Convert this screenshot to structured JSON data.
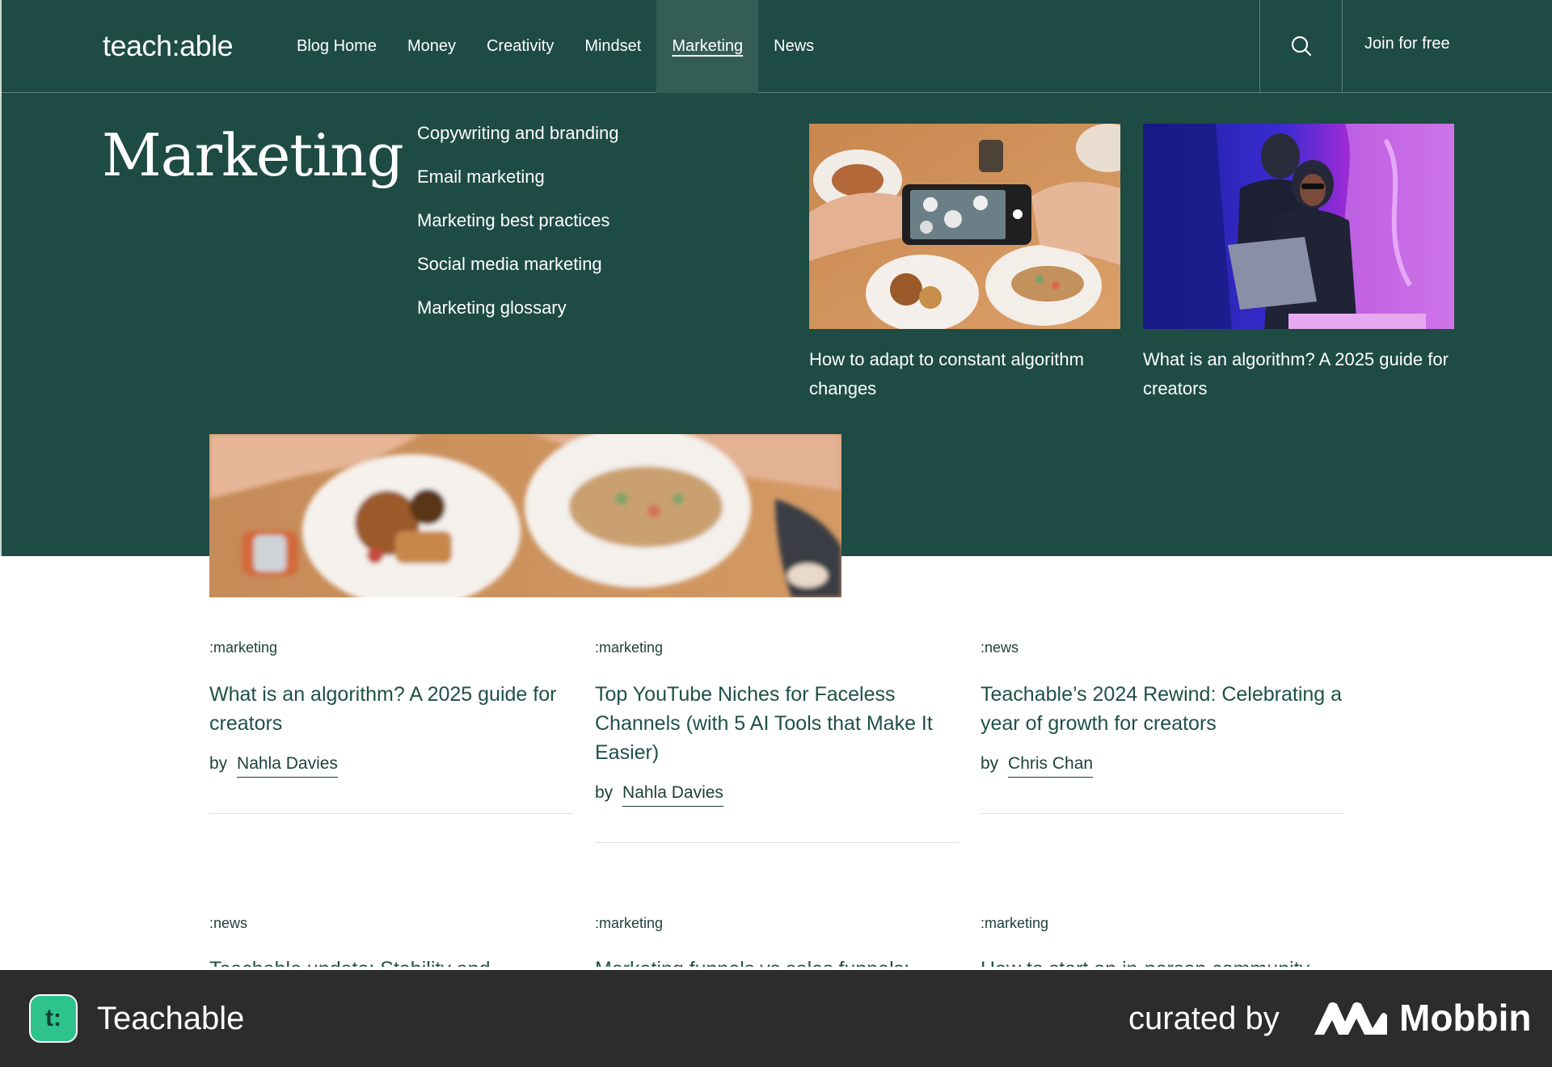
{
  "brand": {
    "logo": "teach:able"
  },
  "nav": {
    "items": [
      {
        "label": "Blog Home",
        "active": false
      },
      {
        "label": "Money",
        "active": false
      },
      {
        "label": "Creativity",
        "active": false
      },
      {
        "label": "Mindset",
        "active": false
      },
      {
        "label": "Marketing",
        "active": true
      },
      {
        "label": "News",
        "active": false
      }
    ],
    "search_icon": "search-icon",
    "join_label": "Join for free"
  },
  "mega_menu": {
    "title": "Marketing",
    "links": [
      "Copywriting and branding",
      "Email marketing",
      "Marketing best practices",
      "Social media marketing",
      "Marketing glossary"
    ],
    "featured": [
      {
        "caption": "How to adapt to constant algorithm changes",
        "image": "phone-photographing-food-image"
      },
      {
        "caption": "What is an algorithm? A 2025 guide for creators",
        "image": "neon-creators-laptop-image"
      }
    ]
  },
  "articles": [
    {
      "tag": ":marketing",
      "title": "What is an algorithm? A 2025 guide for creators",
      "by": "by",
      "author": "Nahla Davies"
    },
    {
      "tag": ":marketing",
      "title": "Top YouTube Niches for Faceless Channels (with 5 AI Tools that Make It Easier)",
      "by": "by",
      "author": "Nahla Davies"
    },
    {
      "tag": ":news",
      "title": "Teachable’s 2024 Rewind: Celebrating a year of growth for creators",
      "by": "by",
      "author": "Chris Chan"
    }
  ],
  "articles_row2": [
    {
      "tag": ":news",
      "title": "Teachable update: Stability and"
    },
    {
      "tag": ":marketing",
      "title": "Marketing funnels vs sales funnels:"
    },
    {
      "tag": ":marketing",
      "title": "How to start an in-person community"
    }
  ],
  "footer": {
    "app_icon_letter": "t:",
    "app_name": "Teachable",
    "curated_by": "curated by",
    "curator": "Mobbin"
  },
  "colors": {
    "header_green": "#1e4b44",
    "active_tab": "#345d56",
    "title_green": "#1f5148",
    "footer_bg": "#2c2c2c",
    "app_icon": "#2ec38c"
  }
}
